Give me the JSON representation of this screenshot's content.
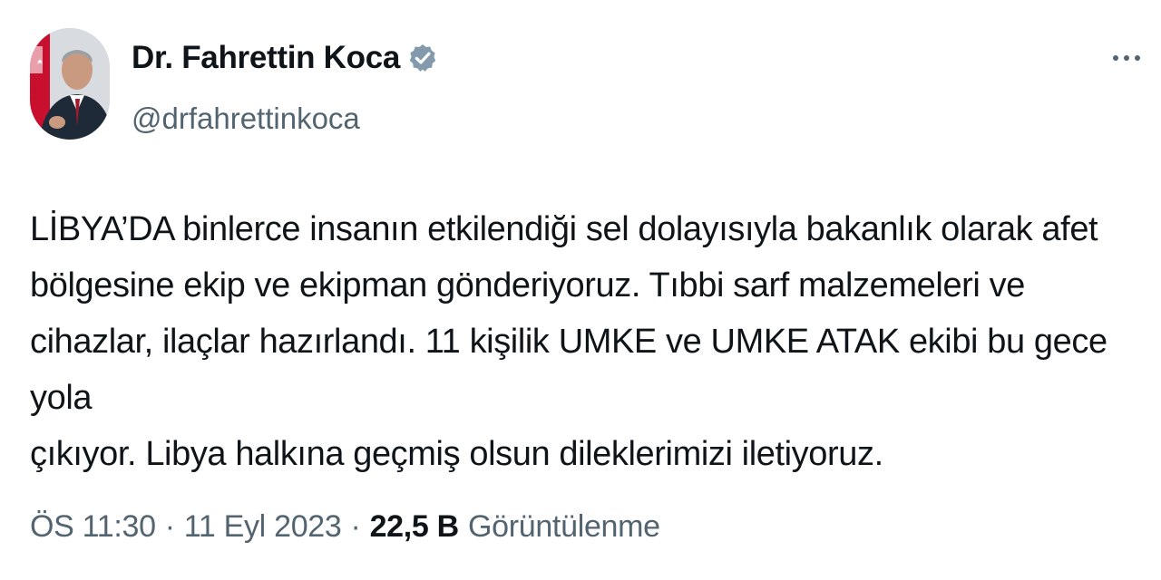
{
  "author": {
    "display_name": "Dr. Fahrettin Koca",
    "handle": "@drfahrettinkoca",
    "verified": true,
    "verified_color": "#829aab"
  },
  "tweet": {
    "text": "LİBYA’DA binlerce insanın etkilendiği sel dolayısıyla bakanlık olarak afet\nbölgesine ekip ve ekipman gönderiyoruz. Tıbbi sarf malzemeleri ve\ncihazlar, ilaçlar hazırlandı. 11 kişilik UMKE ve UMKE ATAK ekibi bu gece yola\nçıkıyor. Libya halkına geçmiş olsun dileklerimizi iletiyoruz."
  },
  "meta": {
    "time": "ÖS 11:30",
    "separator": "·",
    "date": "11 Eyl 2023",
    "views_count": "22,5 B",
    "views_label": "Görüntülenme"
  },
  "icons": {
    "more": "more-horizontal-icon",
    "verified": "verified-badge-icon"
  },
  "colors": {
    "text_primary": "#0f1419",
    "text_secondary": "#536471"
  }
}
